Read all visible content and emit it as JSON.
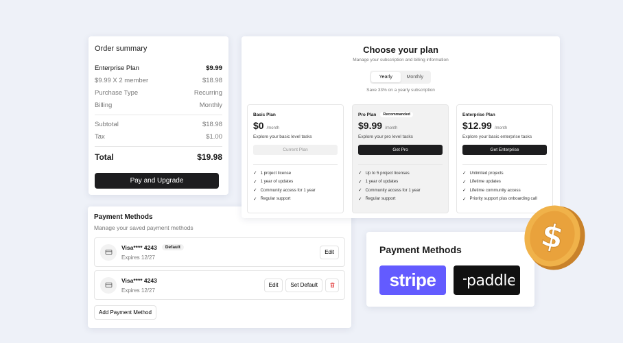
{
  "order_summary": {
    "title": "Order summary",
    "rows": [
      {
        "label": "Enterprise Plan",
        "value": "$9.99"
      },
      {
        "label": "$9.99 X 2 member",
        "value": "$18.98"
      },
      {
        "label": "Purchase Type",
        "value": "Recurring"
      },
      {
        "label": "Billing",
        "value": "Monthly"
      }
    ],
    "subtotal_label": "Subtotal",
    "subtotal_value": "$18.98",
    "tax_label": "Tax",
    "tax_value": "$1.00",
    "total_label": "Total",
    "total_value": "$19.98",
    "pay_button": "Pay and Upgrade"
  },
  "payment_methods": {
    "title": "Payment Methods",
    "subtitle": "Manage your saved payment methods",
    "cards": [
      {
        "name": "Visa**** 4243",
        "badge": "Default",
        "expires": "Expires 12/27",
        "edit": "Edit"
      },
      {
        "name": "Visa**** 4243",
        "expires": "Expires 12/27",
        "edit": "Edit",
        "set_default": "Set Default"
      }
    ],
    "add_button": "Add Payment Method"
  },
  "plans": {
    "title": "Choose your plan",
    "subtitle": "Manage your subscription and billing information",
    "toggle": {
      "yearly": "Yearly",
      "monthly": "Monthly",
      "selected": "Yearly"
    },
    "save_note": "Save 33% on a yearly subscription",
    "items": [
      {
        "name": "Basic Plan",
        "price": "$0",
        "period": "/month",
        "desc": "Explore your basic level tasks",
        "button": "Current Plan",
        "features": [
          "1 project license",
          "1 year of updates",
          "Community access for 1 year",
          "Regular support"
        ]
      },
      {
        "name": "Pro Plan",
        "badge": "Recommanded",
        "price": "$9.99",
        "period": "/month",
        "desc": "Explore your pro level tasks",
        "button": "Get Pro",
        "features": [
          "Up to 5 project licenses",
          "1 year of updates",
          "Community access for 1 year",
          "Regular support"
        ]
      },
      {
        "name": "Enterprise Plan",
        "price": "$12.99",
        "period": "/month",
        "desc": "Explore your basic enterprise tasks",
        "button": "Get Enterprise",
        "features": [
          "Unlimited projects",
          "Lifetime updates",
          "Lifetime community access",
          "Priority support plus onboarding call"
        ]
      }
    ]
  },
  "providers": {
    "title": "Payment Methods",
    "logos": [
      "stripe",
      "paddle"
    ]
  },
  "coin": {
    "symbol": "$"
  },
  "colors": {
    "stripe": "#635bff",
    "paddle": "#111111",
    "dark_button": "#1d1d1f",
    "coin": "#e9a93a",
    "delete": "#e03131"
  }
}
